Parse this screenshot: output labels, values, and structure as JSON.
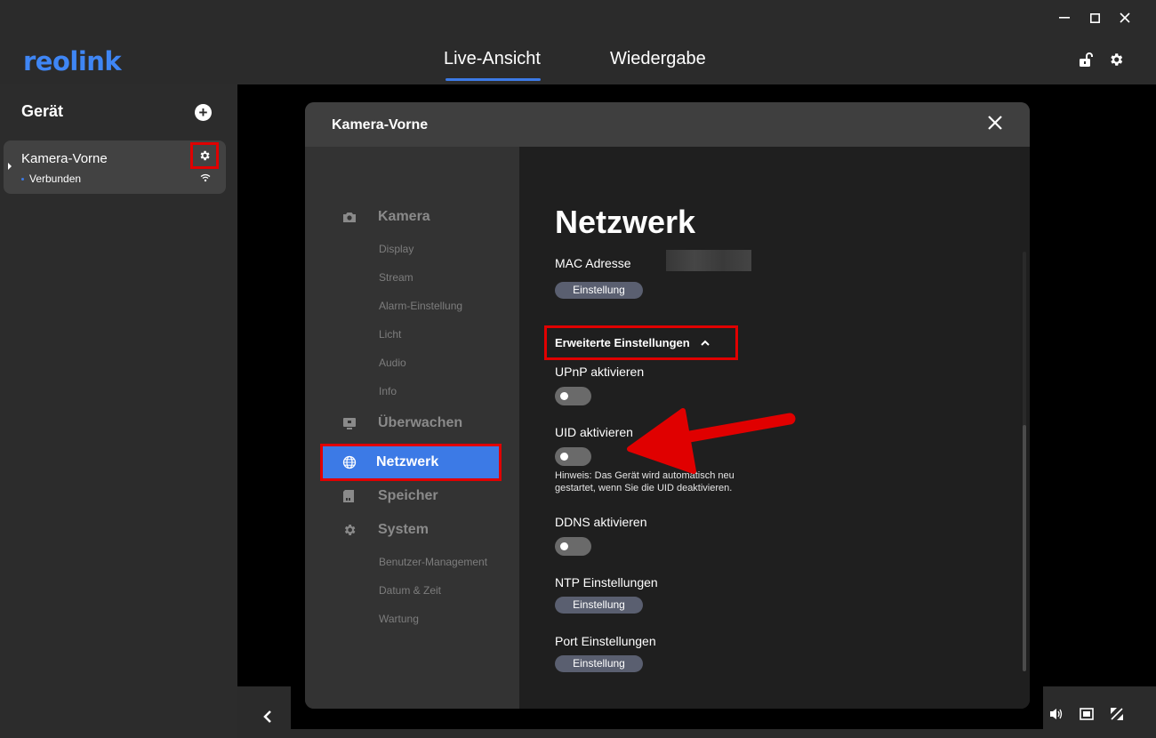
{
  "window": {
    "minimize_icon": "minimize-icon",
    "maximize_icon": "maximize-icon",
    "close_icon": "close-icon"
  },
  "header": {
    "logo": "reolink",
    "tabs": [
      {
        "label": "Live-Ansicht",
        "active": true
      },
      {
        "label": "Wiedergabe",
        "active": false
      }
    ],
    "icons": [
      "unlock-icon",
      "gear-icon"
    ]
  },
  "sidebar": {
    "title": "Gerät",
    "device": {
      "name": "Kamera-Vorne",
      "status": "Verbunden"
    }
  },
  "dialog": {
    "title": "Kamera-Vorne",
    "nav": {
      "kamera": "Kamera",
      "kamera_items": [
        "Display",
        "Stream",
        "Alarm-Einstellung",
        "Licht",
        "Audio",
        "Info"
      ],
      "ueberwachen": "Überwachen",
      "netzwerk": "Netzwerk",
      "speicher": "Speicher",
      "system": "System",
      "system_items": [
        "Benutzer-Management",
        "Datum & Zeit",
        "Wartung"
      ]
    },
    "content": {
      "title": "Netzwerk",
      "mac_label": "MAC Adresse",
      "setting_button": "Einstellung",
      "advanced": "Erweiterte Einstellungen",
      "upnp": "UPnP aktivieren",
      "uid": "UID aktivieren",
      "uid_hint": "Hinweis: Das Gerät wird automatisch neu gestartet, wenn Sie die UID deaktivieren.",
      "ddns": "DDNS aktivieren",
      "ntp": "NTP Einstellungen",
      "port": "Port Einstellungen"
    }
  },
  "colors": {
    "accent": "#3c7ae6",
    "highlight": "#e00000",
    "logo": "#3f86f5"
  }
}
